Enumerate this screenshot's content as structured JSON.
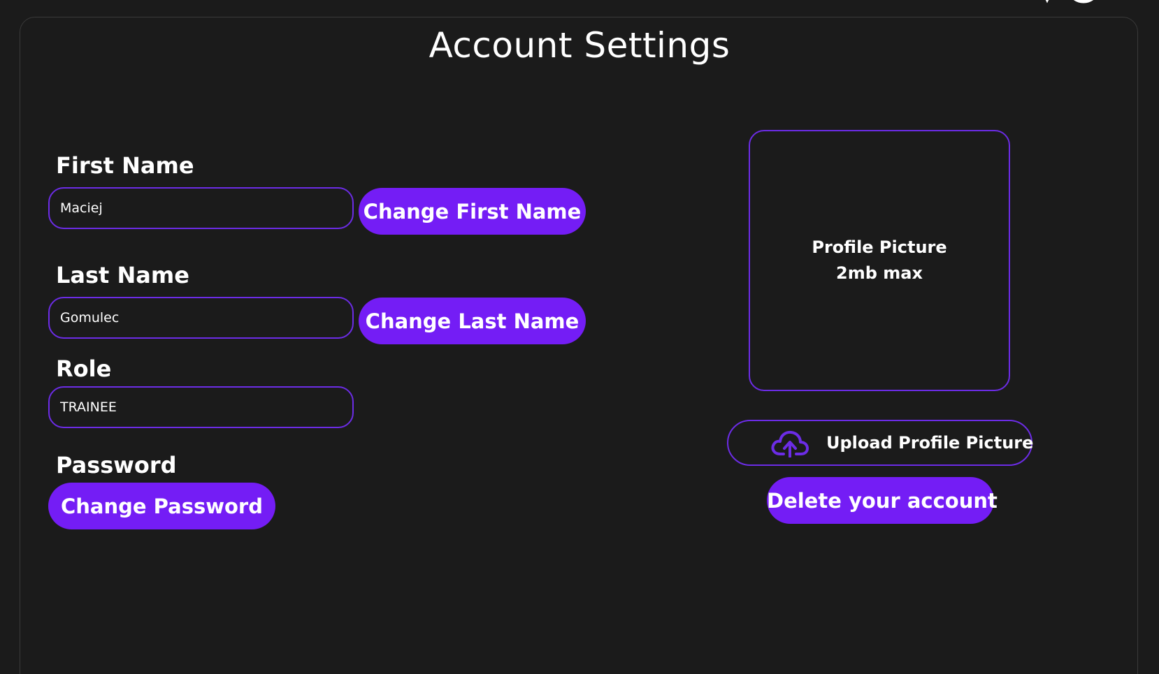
{
  "page": {
    "title": "Account Settings"
  },
  "form": {
    "first_name": {
      "label": "First Name",
      "value": "Maciej",
      "button": "Change First Name"
    },
    "last_name": {
      "label": "Last Name",
      "value": "Gomulec",
      "button": "Change Last Name"
    },
    "role": {
      "label": "Role",
      "value": "TRAINEE"
    },
    "password": {
      "label": "Password",
      "button": "Change Password"
    }
  },
  "profile_picture": {
    "line1": "Profile Picture",
    "line2": "2mb max",
    "upload_button": "Upload Profile Picture",
    "upload_icon": "cloud-upload-icon"
  },
  "account": {
    "delete_button": "Delete your account"
  },
  "colors": {
    "background": "#1b1b1b",
    "accent": "#741df5",
    "border": "#6c2ce6",
    "text": "#ffffff"
  }
}
